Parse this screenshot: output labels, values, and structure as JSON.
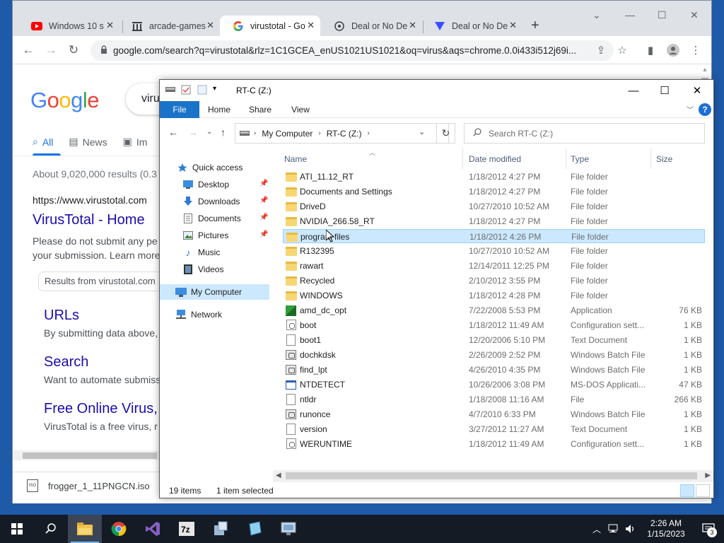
{
  "browser": {
    "tabs": [
      {
        "title": "Windows 10 s",
        "favicon": "youtube-icon",
        "color": "#ff0000"
      },
      {
        "title": "arcade-games",
        "favicon": "archive-icon",
        "color": "#3c4043"
      },
      {
        "title": "virustotal - Go",
        "favicon": "google-icon",
        "color": "#4285f4",
        "active": true
      },
      {
        "title": "Deal or No De",
        "favicon": "deal-icon",
        "color": "#3c4043"
      },
      {
        "title": "Deal or No De",
        "favicon": "virustotal-icon",
        "color": "#394eff"
      }
    ],
    "url": "google.com/search?q=virustotal&rlz=1C1GCEA_enUS1021US1021&oq=virus&aqs=chrome.0.0i433i512j69i..."
  },
  "google": {
    "logo": "Google",
    "query": "viru",
    "tabs": [
      "All",
      "News",
      "Im"
    ],
    "stats": "About 9,020,000 results (0.3",
    "cite": "https://www.virustotal.com",
    "title": "VirusTotal - Home",
    "snippet1": "Please do not submit any pe",
    "snippet2": "your submission. Learn more",
    "chip": "Results from virustotal.com",
    "sub": [
      {
        "title": "URLs",
        "snippet": "By submitting data above,"
      },
      {
        "title": "Search",
        "snippet": "Want to automate submiss"
      },
      {
        "title": "Free Online Virus,",
        "snippet": "VirusTotal is a free virus, r"
      }
    ]
  },
  "download": {
    "file": "frogger_1_11PNGCN.iso",
    "badge": "ISO"
  },
  "explorer": {
    "title": "RT-C (Z:)",
    "ribbon": [
      "File",
      "Home",
      "Share",
      "View"
    ],
    "help": "?",
    "breadcrumb": [
      "My Computer",
      "RT-C (Z:)"
    ],
    "search_placeholder": "Search RT-C (Z:)",
    "nav": [
      {
        "label": "Quick access",
        "icon": "star-icon",
        "pinned": false
      },
      {
        "label": "Desktop",
        "icon": "desktop-icon",
        "pinned": true
      },
      {
        "label": "Downloads",
        "icon": "download-icon",
        "pinned": true
      },
      {
        "label": "Documents",
        "icon": "documents-icon",
        "pinned": true
      },
      {
        "label": "Pictures",
        "icon": "pictures-icon",
        "pinned": true
      },
      {
        "label": "Music",
        "icon": "music-icon",
        "pinned": false
      },
      {
        "label": "Videos",
        "icon": "videos-icon",
        "pinned": false
      },
      {
        "label": "My Computer",
        "icon": "computer-icon",
        "pinned": false,
        "selected": true
      },
      {
        "label": "Network",
        "icon": "network-icon",
        "pinned": false
      }
    ],
    "columns": [
      "Name",
      "Date modified",
      "Type",
      "Size"
    ],
    "files": [
      {
        "name": "ATI_11.12_RT",
        "date": "1/18/2012 4:27 PM",
        "type": "File folder",
        "size": "",
        "icon": "folder"
      },
      {
        "name": "Documents and Settings",
        "date": "1/18/2012 4:27 PM",
        "type": "File folder",
        "size": "",
        "icon": "folder"
      },
      {
        "name": "DriveD",
        "date": "10/27/2010 10:52 AM",
        "type": "File folder",
        "size": "",
        "icon": "folder"
      },
      {
        "name": "NVIDIA_266.58_RT",
        "date": "1/18/2012 4:27 PM",
        "type": "File folder",
        "size": "",
        "icon": "folder"
      },
      {
        "name": "program files",
        "date": "1/18/2012 4:26 PM",
        "type": "File folder",
        "size": "",
        "icon": "folder",
        "selected": true
      },
      {
        "name": "R132395",
        "date": "10/27/2010 10:52 AM",
        "type": "File folder",
        "size": "",
        "icon": "folder"
      },
      {
        "name": "rawart",
        "date": "12/14/2011 12:25 PM",
        "type": "File folder",
        "size": "",
        "icon": "folder"
      },
      {
        "name": "Recycled",
        "date": "2/10/2012 3:55 PM",
        "type": "File folder",
        "size": "",
        "icon": "folder"
      },
      {
        "name": "WINDOWS",
        "date": "1/18/2012 4:28 PM",
        "type": "File folder",
        "size": "",
        "icon": "folder"
      },
      {
        "name": "amd_dc_opt",
        "date": "7/22/2008 5:53 PM",
        "type": "Application",
        "size": "76 KB",
        "icon": "app"
      },
      {
        "name": "boot",
        "date": "1/18/2012 11:49 AM",
        "type": "Configuration sett...",
        "size": "1 KB",
        "icon": "cfg"
      },
      {
        "name": "boot1",
        "date": "12/20/2006 5:10 PM",
        "type": "Text Document",
        "size": "1 KB",
        "icon": "file"
      },
      {
        "name": "dochkdsk",
        "date": "2/26/2009 2:52 PM",
        "type": "Windows Batch File",
        "size": "1 KB",
        "icon": "bat"
      },
      {
        "name": "find_lpt",
        "date": "4/26/2010 4:35 PM",
        "type": "Windows Batch File",
        "size": "1 KB",
        "icon": "bat"
      },
      {
        "name": "NTDETECT",
        "date": "10/26/2006 3:08 PM",
        "type": "MS-DOS Applicati...",
        "size": "47 KB",
        "icon": "dos"
      },
      {
        "name": "ntldr",
        "date": "1/18/2008 11:16 AM",
        "type": "File",
        "size": "266 KB",
        "icon": "file"
      },
      {
        "name": "runonce",
        "date": "4/7/2010 6:33 PM",
        "type": "Windows Batch File",
        "size": "1 KB",
        "icon": "bat"
      },
      {
        "name": "version",
        "date": "3/27/2012 11:27 AM",
        "type": "Text Document",
        "size": "1 KB",
        "icon": "file"
      },
      {
        "name": "WERUNTIME",
        "date": "1/18/2012 11:49 AM",
        "type": "Configuration sett...",
        "size": "1 KB",
        "icon": "cfg"
      }
    ],
    "status": {
      "count": "19 items",
      "selected": "1 item selected"
    }
  },
  "taskbar": {
    "time": "2:26 AM",
    "date": "1/15/2023",
    "notifications": "3",
    "apps": [
      "file-explorer-icon",
      "chrome-icon",
      "visual-studio-icon",
      "7zip-icon",
      "installer-icon",
      "notepad-icon",
      "network-app-icon"
    ]
  },
  "colors": {
    "accent": "#1a73c8",
    "selection": "#cce8ff",
    "link": "#1a0dab",
    "google_blue": "#4285f4"
  }
}
